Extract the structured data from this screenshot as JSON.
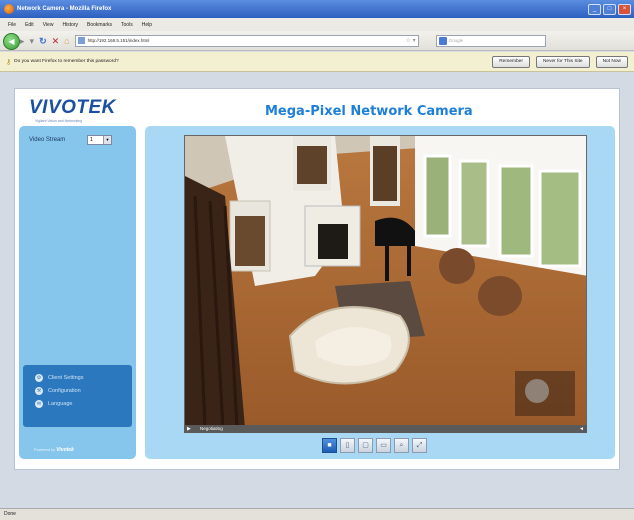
{
  "window": {
    "title": "Network Camera - Mozilla Firefox"
  },
  "menu": [
    "File",
    "Edit",
    "View",
    "History",
    "Bookmarks",
    "Tools",
    "Help"
  ],
  "nav": {
    "url": "http://192.168.5.151/index.html",
    "search_placeholder": "Google"
  },
  "password_bar": {
    "message": "Do you want Firefox to remember this password?",
    "remember": "Remember",
    "never": "Never for This Site",
    "not_now": "Not Now"
  },
  "page": {
    "logo": "VIVOTEK",
    "tagline": "Vigilant Vision and Networking",
    "title": "Mega-Pixel Network Camera",
    "video_stream_label": "Video Stream",
    "video_stream_value": "1",
    "sidelinks": [
      {
        "label": "Client Settings",
        "icon": "gear-icon"
      },
      {
        "label": "Configuration",
        "icon": "wrench-icon"
      },
      {
        "label": "Language",
        "icon": "speech-bubble-icon"
      }
    ],
    "powered_by": "Powered by",
    "powered_brand": "Vivotek",
    "video_status": "Negotiating"
  },
  "browser_status": "Done"
}
